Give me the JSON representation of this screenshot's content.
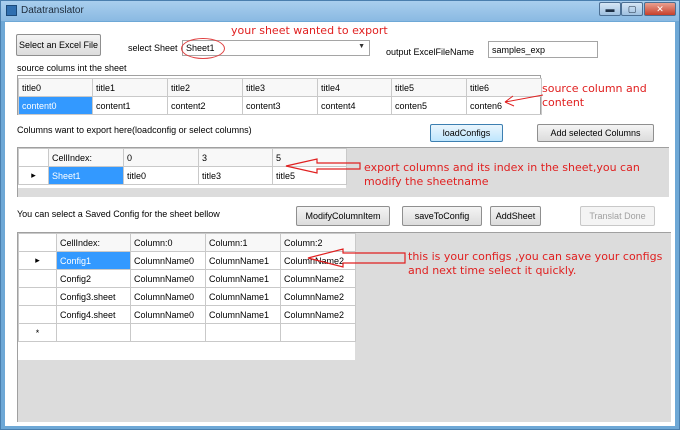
{
  "window": {
    "title": "Datatranslator"
  },
  "titlebar_buttons": {
    "minimize": "▬",
    "maximize": "▢",
    "close": "✕"
  },
  "top": {
    "select_file_label": "Select an Excel File",
    "select_sheet_label": "select Sheet",
    "sheet_value": "Sheet1",
    "output_label": "output ExcelFileName",
    "output_value": "samples_exp"
  },
  "source": {
    "title": "source colums int the sheet",
    "headers": [
      "title0",
      "title1",
      "title2",
      "title3",
      "title4",
      "title5",
      "title6"
    ],
    "row": [
      "content0",
      "content1",
      "content2",
      "content3",
      "content4",
      "conten5",
      "conten6"
    ]
  },
  "export": {
    "title": "Columns want to export here(loadconfig or select columns)",
    "load_btn": "loadConfigs",
    "add_cols_btn": "Add selected Columns",
    "headers": [
      "CellIndex:",
      "0",
      "3",
      "5"
    ],
    "row": [
      "Sheet1",
      "title0",
      "title3",
      "title5"
    ],
    "row_marker": "▸"
  },
  "configs": {
    "title": "You can select a Saved Config for the sheet bellow",
    "modify_btn": "ModifyColumnItem",
    "save_btn": "saveToConfig",
    "add_sheet_btn": "AddSheet",
    "done_btn": "Translat Done",
    "headers": [
      "CellIndex:",
      "Column:0",
      "Column:1",
      "Column:2"
    ],
    "rows": [
      [
        "Config1",
        "ColumnName0",
        "ColumnName1",
        "ColumnName2"
      ],
      [
        "Config2",
        "ColumnName0",
        "ColumnName1",
        "ColumnName2"
      ],
      [
        "Config3.sheet",
        "ColumnName0",
        "ColumnName1",
        "ColumnName2"
      ],
      [
        "Config4.sheet",
        "ColumnName0",
        "ColumnName1",
        "ColumnName2"
      ]
    ],
    "row_marker": "▸",
    "new_row_marker": "*"
  },
  "annotations": {
    "sheet": "your sheet wanted to export",
    "source_line1": "source column and",
    "source_line2": "content",
    "export_line1": "export columns and its index in the sheet,you can",
    "export_line2": "modify the sheetname",
    "config_line1": "this is your configs ,you can save your configs",
    "config_line2": "and next time select it quickly."
  },
  "colors": {
    "selection": "#3399ff",
    "annotation": "#e02020"
  }
}
